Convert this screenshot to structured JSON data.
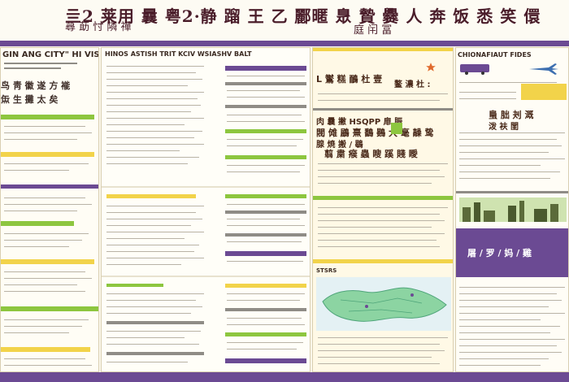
{
  "header": {
    "title_line1": "亖2 莱用 曩 粤2·静 蹓 王 乙 酈暱 臮 贄 爨 人 奔 饭 悉 笑 儇",
    "title_line2": "蕁 莇 忖 隣 禪",
    "title_line3": "庭 闬 冨"
  },
  "panels": {
    "left": {
      "heading": "GIN ANG CITY\" HI VISITS",
      "lines": [
        "鸟 靑 徽 遂 方 褦",
        "缹 生 攤 太 矣"
      ]
    },
    "center_left": {
      "heading": "HINOS ASTISH TRIT KCIV WSIASHV BALT"
    },
    "center": {
      "line1": "L  鸑 糕 鴯 杜 壹",
      "line2": "鳌 濃 杜 :",
      "line3": "肉 曩 撇 HSQPP  扉 脤",
      "line4": "閥 傩 鶌 熹 鷭 鷃 大 毫 髞 鸷",
      "line5": "腺 焼 搬 / 鶡",
      "line6": "翦 粛 瘊 蟲 瞍 蹊 賤 瞹",
      "map_heading": "STSRS"
    },
    "right": {
      "heading": "CHIONAFIAUT FIDES",
      "line1": "蛗 朏 刔 溉",
      "line2": "泼 衭 閨",
      "banner": "屠 / 罗 / 妈 / 雞"
    }
  },
  "colors": {
    "band": "#6b4a93",
    "green": "#8dc63f",
    "yellow": "#f2d34a",
    "purple": "#6b4a93",
    "paper": "#fbf7ea",
    "ink": "#3a2a22"
  },
  "icons": [
    "star-icon",
    "bus-icon",
    "plane-icon",
    "city-skyline-icon",
    "map-icon"
  ]
}
